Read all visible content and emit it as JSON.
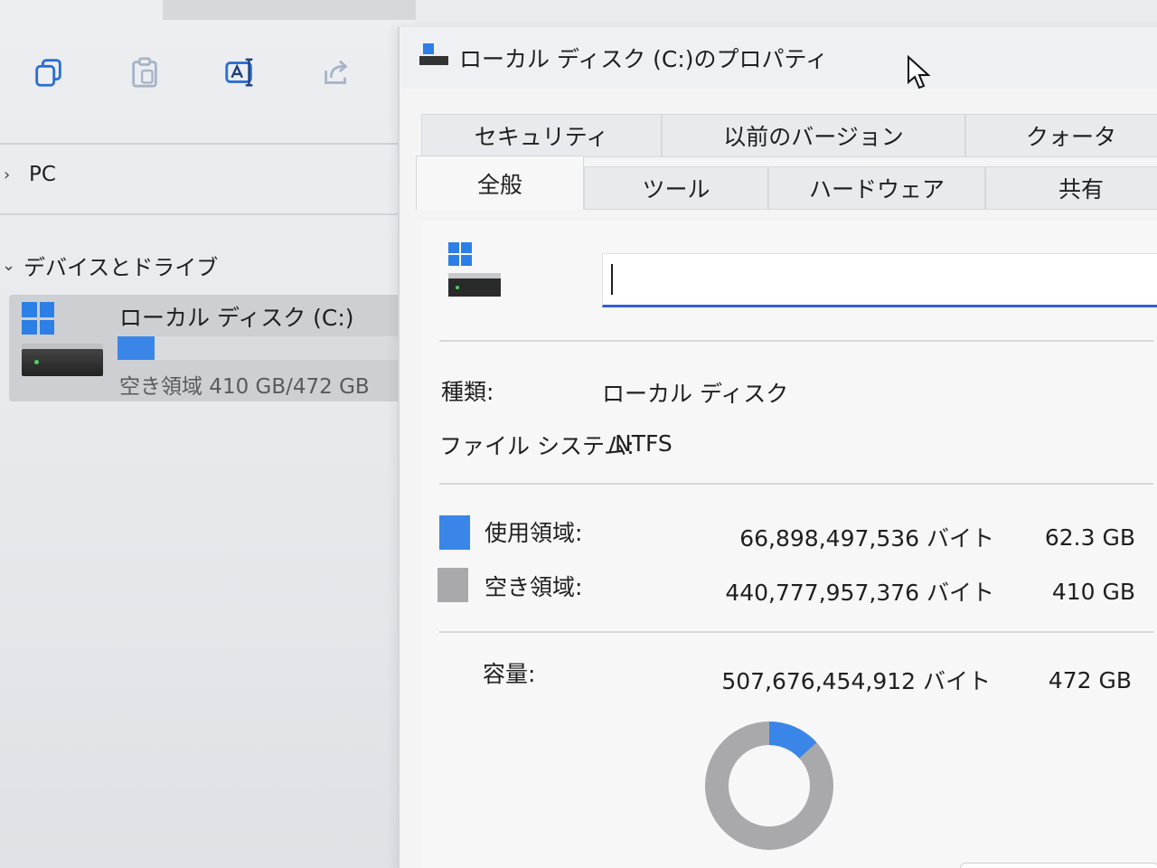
{
  "explorer": {
    "toolbar": [
      {
        "name": "copy-icon"
      },
      {
        "name": "paste-icon"
      },
      {
        "name": "rename-icon"
      },
      {
        "name": "share-icon"
      }
    ],
    "nav": {
      "pc_label": "PC",
      "group_label": "デバイスとドライブ"
    },
    "drive": {
      "name": "ローカル ディスク (C:)",
      "free_text": "空き領域 410 GB/472 GB",
      "used_fraction": 0.132
    }
  },
  "dialog": {
    "title": "ローカル ディスク (C:)のプロパティ",
    "tabs_row1": [
      {
        "label": "セキュリティ"
      },
      {
        "label": "以前のバージョン"
      },
      {
        "label": "クォータ"
      }
    ],
    "tabs_row2": [
      {
        "label": "全般"
      },
      {
        "label": "ツール"
      },
      {
        "label": "ハードウェア"
      },
      {
        "label": "共有"
      }
    ],
    "volume_name_value": "",
    "type_label": "種類:",
    "type_value": "ローカル ディスク",
    "fs_label": "ファイル システム:",
    "fs_value": "NTFS",
    "used_label": "使用領域:",
    "used_bytes": "66,898,497,536 バイト",
    "used_gb": "62.3 GB",
    "free_label": "空き領域:",
    "free_bytes": "440,777,957,376 バイト",
    "free_gb": "410 GB",
    "capacity_label": "容量:",
    "capacity_bytes": "507,676,454,912 バイト",
    "capacity_gb": "472 GB",
    "colors": {
      "used": "#3a86e8",
      "free": "#a9a9ab"
    },
    "usage_fraction": 0.132
  }
}
